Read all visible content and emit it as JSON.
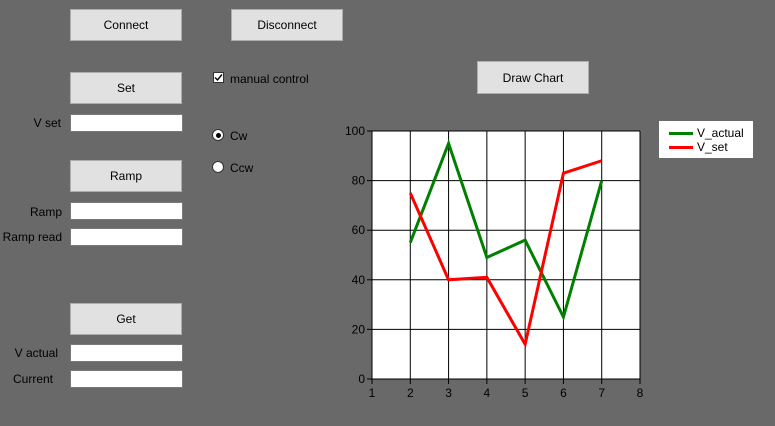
{
  "buttons": {
    "connect": "Connect",
    "disconnect": "Disconnect",
    "set": "Set",
    "ramp": "Ramp",
    "get": "Get",
    "draw_chart": "Draw Chart"
  },
  "labels": {
    "v_set": "V set",
    "ramp": "Ramp",
    "ramp_read": "Ramp read",
    "v_actual": "V actual",
    "current": "Current"
  },
  "fields": {
    "v_set": "",
    "ramp": "",
    "ramp_read": "",
    "v_actual": "",
    "current": ""
  },
  "manual_control": {
    "label": "manual control",
    "checked": true
  },
  "direction": {
    "options": [
      "Cw",
      "Ccw"
    ],
    "selected": "Cw"
  },
  "colors": {
    "background": "#696969",
    "v_actual": "#008000",
    "v_set": "#ff0000"
  },
  "chart_data": {
    "type": "line",
    "x_ticks": [
      1,
      2,
      3,
      4,
      5,
      6,
      7,
      8
    ],
    "y_ticks": [
      0,
      20,
      40,
      60,
      80,
      100
    ],
    "xlim": [
      1,
      8
    ],
    "ylim": [
      0,
      100
    ],
    "grid": true,
    "legend_position": "top-right outside",
    "series": [
      {
        "name": "V_actual",
        "color": "#008000",
        "x": [
          2,
          3,
          4,
          5,
          6,
          7
        ],
        "y": [
          55,
          95,
          49,
          56,
          25,
          80
        ]
      },
      {
        "name": "V_set",
        "color": "#ff0000",
        "x": [
          2,
          3,
          4,
          5,
          6,
          7
        ],
        "y": [
          75,
          40,
          41,
          14,
          83,
          88
        ]
      }
    ]
  }
}
